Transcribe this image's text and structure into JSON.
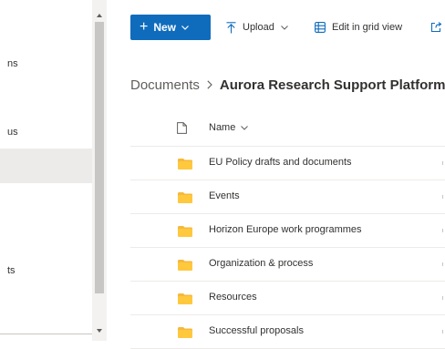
{
  "leftnav": {
    "items": [
      {
        "label": "ns"
      },
      {
        "label": "us"
      },
      {
        "label": ""
      },
      {
        "label": "ts"
      }
    ]
  },
  "commandbar": {
    "new_label": "New",
    "upload_label": "Upload",
    "edit_grid_label": "Edit in grid view"
  },
  "breadcrumb": {
    "root": "Documents",
    "current": "Aurora Research Support Platform"
  },
  "list": {
    "column_name": "Name",
    "rows": [
      {
        "name": "EU Policy drafts and documents",
        "type": "folder"
      },
      {
        "name": "Events",
        "type": "folder"
      },
      {
        "name": "Horizon Europe work programmes",
        "type": "folder"
      },
      {
        "name": "Organization & process",
        "type": "folder"
      },
      {
        "name": "Resources",
        "type": "folder"
      },
      {
        "name": "Successful proposals",
        "type": "folder"
      }
    ]
  },
  "colors": {
    "accent": "#0f6cbd",
    "folder": "#f4b93e",
    "selected_nav": "#edebe9"
  },
  "icons": [
    "plus-icon",
    "chevron-down-icon",
    "upload-icon",
    "grid-icon",
    "share-icon",
    "document-icon",
    "folder-icon"
  ]
}
